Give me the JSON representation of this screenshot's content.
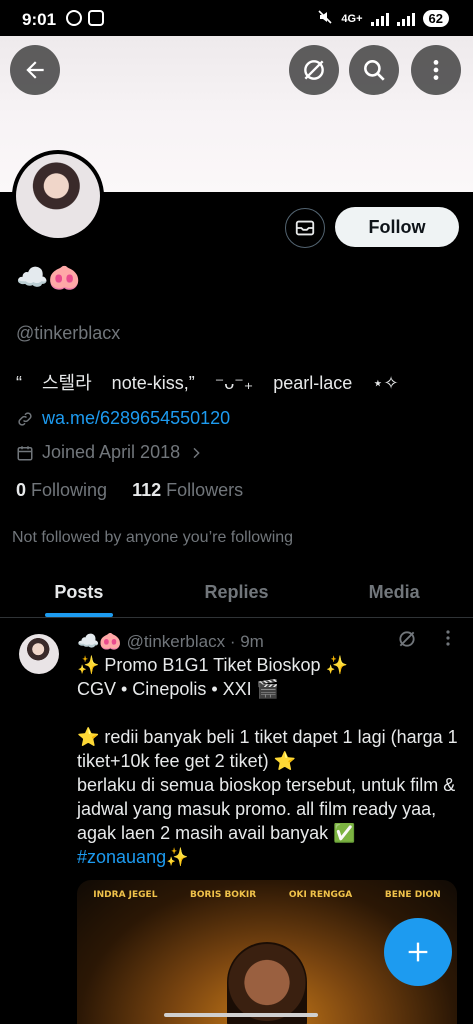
{
  "status_bar": {
    "time": "9:01",
    "battery": "62",
    "network": "4G+"
  },
  "header": {
    "back_icon": "arrow-left-icon",
    "grok_icon": "grok-icon",
    "search_icon": "search-icon",
    "more_icon": "more-vertical-icon"
  },
  "profile": {
    "display_name": "☁️🐽",
    "handle": "@tinkerblacx",
    "bio": "“    스텔라    note-kiss,”    ⁻ᴗ⁻₊    pearl-lace    ⋆✧",
    "link": "wa.me/6289654550120",
    "joined": "Joined April 2018",
    "following_count": "0",
    "following_label": "Following",
    "followers_count": "112",
    "followers_label": "Followers",
    "not_followed": "Not followed by anyone you’re following",
    "follow_label": "Follow"
  },
  "tabs": [
    {
      "label": "Posts",
      "active": true
    },
    {
      "label": "Replies",
      "active": false
    },
    {
      "label": "Media",
      "active": false
    }
  ],
  "post": {
    "display_name": "☁️🐽",
    "handle": "@tinkerblacx",
    "time": "· 9m",
    "line1": "✨ Promo B1G1 Tiket Bioskop ✨",
    "line2": "CGV • Cinepolis • XXI 🎬",
    "line3": "⭐ redii banyak beli 1 tiket dapet 1 lagi (harga 1 tiket+10k fee get 2 tiket) ⭐",
    "line4": "berlaku di semua bioskop tersebut, untuk film & jadwal yang masuk promo. all film ready yaa, agak laen 2 masih avail banyak ✅",
    "hashtag": "#zonauang",
    "hashtag_emoji": "✨",
    "media_cast": [
      "INDRA JEGEL",
      "BORIS BOKIR",
      "OKI RENGGA",
      "BENE DION"
    ]
  },
  "colors": {
    "accent": "#1d9bf0",
    "background": "#000000",
    "muted": "#71767b"
  }
}
